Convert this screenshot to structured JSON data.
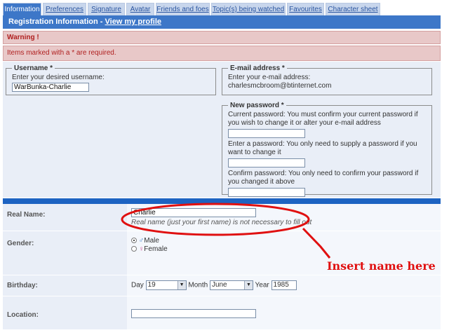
{
  "tabs": [
    {
      "label": "Information"
    },
    {
      "label": "Preferences"
    },
    {
      "label": "Signature"
    },
    {
      "label": "Avatar"
    },
    {
      "label": "Friends and foes"
    },
    {
      "label": "Topic(s) being watched"
    },
    {
      "label": "Favourites"
    },
    {
      "label": "Character sheet"
    }
  ],
  "header": {
    "title": "Registration Information - ",
    "profile_link": "View my profile"
  },
  "warning": {
    "title": "Warning !",
    "message": "Items marked with a * are required."
  },
  "username": {
    "legend": "Username *",
    "help": "Enter your desired username:",
    "value": "WarBunka-Charlie"
  },
  "email": {
    "legend": "E-mail address *",
    "help": "Enter your e-mail address:",
    "value": "charlesmcbroom@btinternet.com"
  },
  "password": {
    "legend": "New password *",
    "current_help": "Current password: You must confirm your current password if you wish to change it or alter your e-mail address",
    "new_help": "Enter a password: You only need to supply a password if you want to change it",
    "confirm_help": "Confirm password: You only need to confirm your password if you changed it above"
  },
  "real_name": {
    "label": "Real Name:",
    "value": "Charlie",
    "note": "Real name (just your first name) is not necessary to fill out"
  },
  "gender": {
    "label": "Gender:",
    "male": "Male",
    "female": "Female",
    "male_symbol": "♂",
    "female_symbol": "♀"
  },
  "birthday": {
    "label": "Birthday:",
    "day_label": "Day",
    "day": "19",
    "month_label": "Month",
    "month": "June",
    "year_label": "Year",
    "year": "1985"
  },
  "location": {
    "label": "Location:",
    "value": ""
  },
  "annotation": {
    "text": "Insert name here",
    "color": "#e01010"
  },
  "colors": {
    "accent": "#3d77c8",
    "panel": "#e9eef7",
    "warning_bg": "#e8c8c8",
    "highlight": "#e01010"
  }
}
